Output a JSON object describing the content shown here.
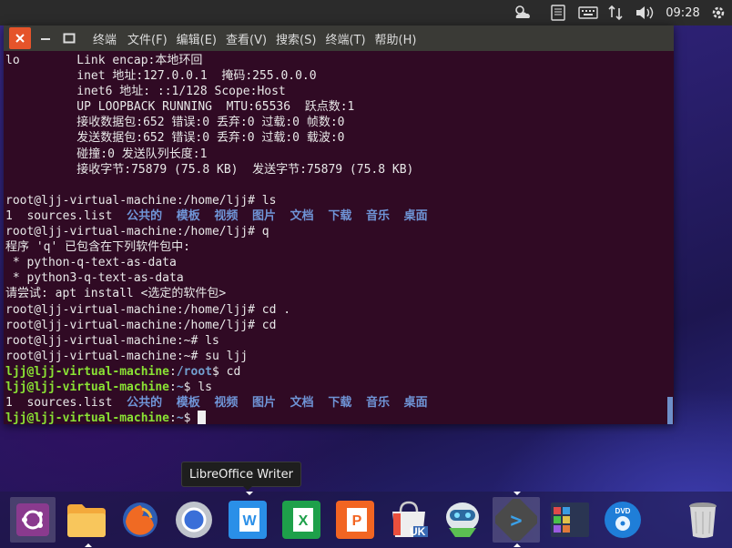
{
  "top_panel": {
    "tray_icons": [
      "weather-icon",
      "keyboard-icon",
      "keyboard-layout-icon",
      "network-icon",
      "volume-icon"
    ],
    "clock": "09:28",
    "power_icon": "gear-icon"
  },
  "terminal": {
    "title": "终端",
    "menu": [
      "文件(F)",
      "编辑(E)",
      "查看(V)",
      "搜索(S)",
      "终端(T)",
      "帮助(H)"
    ],
    "lines": [
      {
        "segments": [
          {
            "t": "lo        Link encap:本地环回",
            "c": ""
          }
        ]
      },
      {
        "segments": [
          {
            "t": "          inet 地址:127.0.0.1  掩码:255.0.0.0",
            "c": ""
          }
        ]
      },
      {
        "segments": [
          {
            "t": "          inet6 地址: ::1/128 Scope:Host",
            "c": ""
          }
        ]
      },
      {
        "segments": [
          {
            "t": "          UP LOOPBACK RUNNING  MTU:65536  跃点数:1",
            "c": ""
          }
        ]
      },
      {
        "segments": [
          {
            "t": "          接收数据包:652 错误:0 丢弃:0 过载:0 帧数:0",
            "c": ""
          }
        ]
      },
      {
        "segments": [
          {
            "t": "          发送数据包:652 错误:0 丢弃:0 过载:0 载波:0",
            "c": ""
          }
        ]
      },
      {
        "segments": [
          {
            "t": "          碰撞:0 发送队列长度:1",
            "c": ""
          }
        ]
      },
      {
        "segments": [
          {
            "t": "          接收字节:75879 (75.8 KB)  发送字节:75879 (75.8 KB)",
            "c": ""
          }
        ]
      },
      {
        "segments": [
          {
            "t": "",
            "c": ""
          }
        ]
      },
      {
        "segments": [
          {
            "t": "root@ljj-virtual-machine:/home/ljj# ls",
            "c": ""
          }
        ]
      },
      {
        "segments": [
          {
            "t": "1  sources.list  ",
            "c": ""
          },
          {
            "t": "公共的  模板  视频  图片  文档  下载  音乐  桌面",
            "c": "blue"
          }
        ]
      },
      {
        "segments": [
          {
            "t": "root@ljj-virtual-machine:/home/ljj# q",
            "c": ""
          }
        ]
      },
      {
        "segments": [
          {
            "t": "程序 'q' 已包含在下列软件包中:",
            "c": ""
          }
        ]
      },
      {
        "segments": [
          {
            "t": " * python-q-text-as-data",
            "c": ""
          }
        ]
      },
      {
        "segments": [
          {
            "t": " * python3-q-text-as-data",
            "c": ""
          }
        ]
      },
      {
        "segments": [
          {
            "t": "请尝试: apt install <选定的软件包>",
            "c": ""
          }
        ]
      },
      {
        "segments": [
          {
            "t": "root@ljj-virtual-machine:/home/ljj# cd .",
            "c": ""
          }
        ]
      },
      {
        "segments": [
          {
            "t": "root@ljj-virtual-machine:/home/ljj# cd",
            "c": ""
          }
        ]
      },
      {
        "segments": [
          {
            "t": "root@ljj-virtual-machine:~# ls",
            "c": ""
          }
        ]
      },
      {
        "segments": [
          {
            "t": "root@ljj-virtual-machine:~# su ljj",
            "c": ""
          }
        ]
      },
      {
        "segments": [
          {
            "t": "ljj@ljj-virtual-machine",
            "c": "green"
          },
          {
            "t": ":",
            "c": ""
          },
          {
            "t": "/root",
            "c": "pblue"
          },
          {
            "t": "$ cd",
            "c": ""
          }
        ]
      },
      {
        "segments": [
          {
            "t": "ljj@ljj-virtual-machine",
            "c": "green"
          },
          {
            "t": ":",
            "c": ""
          },
          {
            "t": "~",
            "c": "pblue"
          },
          {
            "t": "$ ls",
            "c": ""
          }
        ]
      },
      {
        "segments": [
          {
            "t": "1  sources.list  ",
            "c": ""
          },
          {
            "t": "公共的  模板  视频  图片  文档  下载  音乐  桌面",
            "c": "blue"
          }
        ]
      },
      {
        "segments": [
          {
            "t": "ljj@ljj-virtual-machine",
            "c": "green"
          },
          {
            "t": ":",
            "c": ""
          },
          {
            "t": "~",
            "c": "pblue"
          },
          {
            "t": "$ ",
            "c": ""
          }
        ],
        "cursor": true
      }
    ]
  },
  "tooltip": {
    "text": "LibreOffice Writer"
  },
  "dock": {
    "items": [
      {
        "name": "ubuntu-dash-icon"
      },
      {
        "name": "files-icon"
      },
      {
        "name": "firefox-icon"
      },
      {
        "name": "chromium-icon"
      },
      {
        "name": "writer-icon",
        "label": "W"
      },
      {
        "name": "calc-icon",
        "label": "X"
      },
      {
        "name": "impress-icon",
        "label": "P"
      },
      {
        "name": "software-center-icon",
        "label": "UK"
      },
      {
        "name": "robot-icon"
      },
      {
        "name": "terminal-icon",
        "label": ">"
      },
      {
        "name": "workspace-switcher-icon"
      },
      {
        "name": "dvd-icon",
        "label": "DVD"
      },
      {
        "name": "trash-icon"
      }
    ]
  },
  "colors": {
    "terminal_bg": "#300a24",
    "prompt_user": "#8ae234",
    "prompt_path": "#729fcf",
    "dir_blue": "#6f94d6",
    "close_button": "#e5542a"
  }
}
